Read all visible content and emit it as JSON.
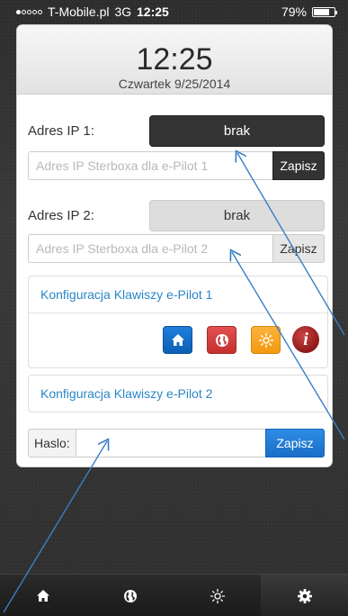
{
  "status_bar": {
    "carrier": "T-Mobile.pl",
    "network": "3G",
    "time": "12:25",
    "battery_percent": "79%",
    "battery_level": 0.79
  },
  "clock": {
    "time": "12:25",
    "date": "Czwartek 9/25/2014"
  },
  "ip1": {
    "label": "Adres IP 1:",
    "status": "brak",
    "placeholder": "Adres IP Sterboxa dla e-Pilot 1",
    "save_label": "Zapisz"
  },
  "ip2": {
    "label": "Adres IP 2:",
    "status": "brak",
    "placeholder": "Adres IP Sterboxa dla e-Pilot 2",
    "save_label": "Zapisz"
  },
  "config1": {
    "link_label": "Konfiguracja Klawiszy e-Pilot 1",
    "icons": [
      "home-icon",
      "globe-icon",
      "sun-icon",
      "info-icon"
    ],
    "info_glyph": "i"
  },
  "config2": {
    "link_label": "Konfiguracja Klawiszy e-Pilot 2"
  },
  "password": {
    "label": "Haslo:",
    "value": "",
    "save_label": "Zapisz"
  },
  "tab_bar": {
    "tabs": [
      "home-icon",
      "globe-icon",
      "sun-icon",
      "gear-icon"
    ],
    "active_tab": "gear-icon"
  },
  "colors": {
    "accent_blue": "#1a6fc7",
    "link_blue": "#2a86c6",
    "dark_button": "#333333",
    "red_button": "#c43030",
    "orange_button": "#f39a10",
    "arrow_blue": "#3a7fc4"
  }
}
